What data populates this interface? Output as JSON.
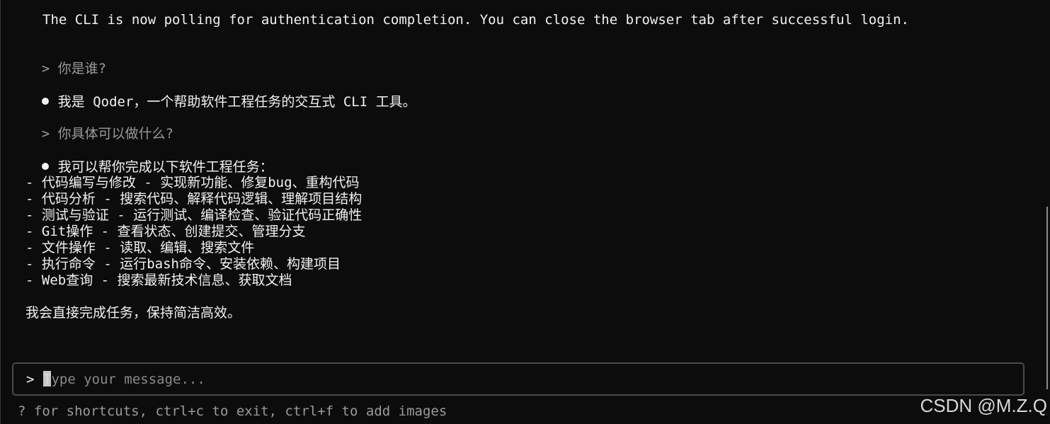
{
  "transcript": {
    "auth_notice": "The CLI is now polling for authentication completion. You can close the browser tab after successful login.",
    "turns": [
      {
        "prompt_marker": ">",
        "user_message": "你是谁?"
      },
      {
        "assistant_message": "我是 Qoder，一个帮助软件工程任务的交互式 CLI 工具。"
      },
      {
        "prompt_marker": ">",
        "user_message": "你具体可以做什么?"
      },
      {
        "assistant_intro": "我可以帮你完成以下软件工程任务：",
        "list_items": [
          "- 代码编写与修改 - 实现新功能、修复bug、重构代码",
          "- 代码分析 - 搜索代码、解释代码逻辑、理解项目结构",
          "- 测试与验证 - 运行测试、编译检查、验证代码正确性",
          "- Git操作 - 查看状态、创建提交、管理分支",
          "- 文件操作 - 读取、编辑、搜索文件",
          "- 执行命令 - 运行bash命令、安装依赖、构建项目",
          "- Web查询 - 搜索最新技术信息、获取文档"
        ],
        "closing": "我会直接完成任务，保持简洁高效。"
      }
    ]
  },
  "input": {
    "prompt_marker": ">",
    "value": "",
    "placeholder": "Type your message..."
  },
  "footer": {
    "hint": "? for shortcuts, ctrl+c to exit, ctrl+f to add images"
  },
  "watermark": "CSDN @M.Z.Q"
}
